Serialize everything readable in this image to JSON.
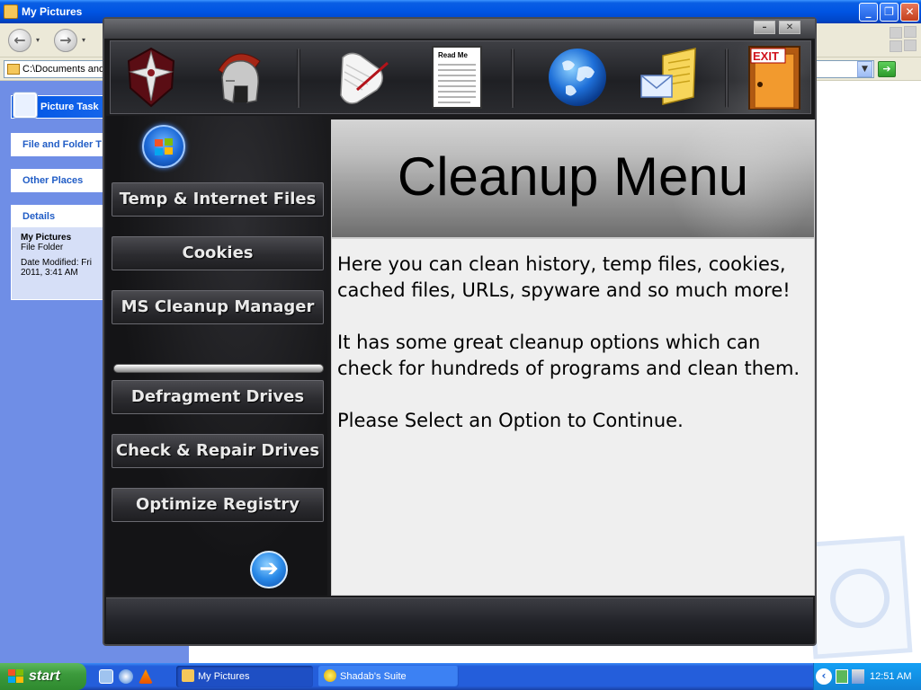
{
  "explorer": {
    "title": "My Pictures",
    "address": "C:\\Documents and",
    "nav_drop": "▾",
    "tasks": {
      "picture_tasks": "Picture Task",
      "file_folder": "File and Folder T",
      "other_places": "Other Places",
      "details_title": "Details",
      "details_name": "My Pictures",
      "details_type": "File Folder",
      "details_modified_1": "Date Modified: Fri",
      "details_modified_2": "2011, 3:41 AM"
    }
  },
  "taskbar": {
    "start": "start",
    "buttons": [
      {
        "label": "My Pictures"
      },
      {
        "label": "Shadab's Suite"
      }
    ],
    "clock": "12:51 AM"
  },
  "app": {
    "toolbar_icons": [
      "shield-icon",
      "helmet-icon",
      "scroll-pen-icon",
      "readme-icon",
      "globe-icon",
      "mail-icon",
      "exit-door-icon"
    ],
    "readme_text": "Read Me",
    "exit_text": "EXIT",
    "menu": [
      "Temp & Internet Files",
      "Cookies",
      "MS Cleanup Manager",
      "Defragment Drives",
      "Check & Repair Drives",
      "Optimize Registry"
    ],
    "panel": {
      "title": "Cleanup Menu",
      "para1": "Here you can clean history, temp files, cookies, cached files, URLs, spyware and so much more!",
      "para2": "It has some great cleanup options which can check for hundreds of programs and clean them.",
      "para3": "Please Select an Option to Continue."
    }
  }
}
